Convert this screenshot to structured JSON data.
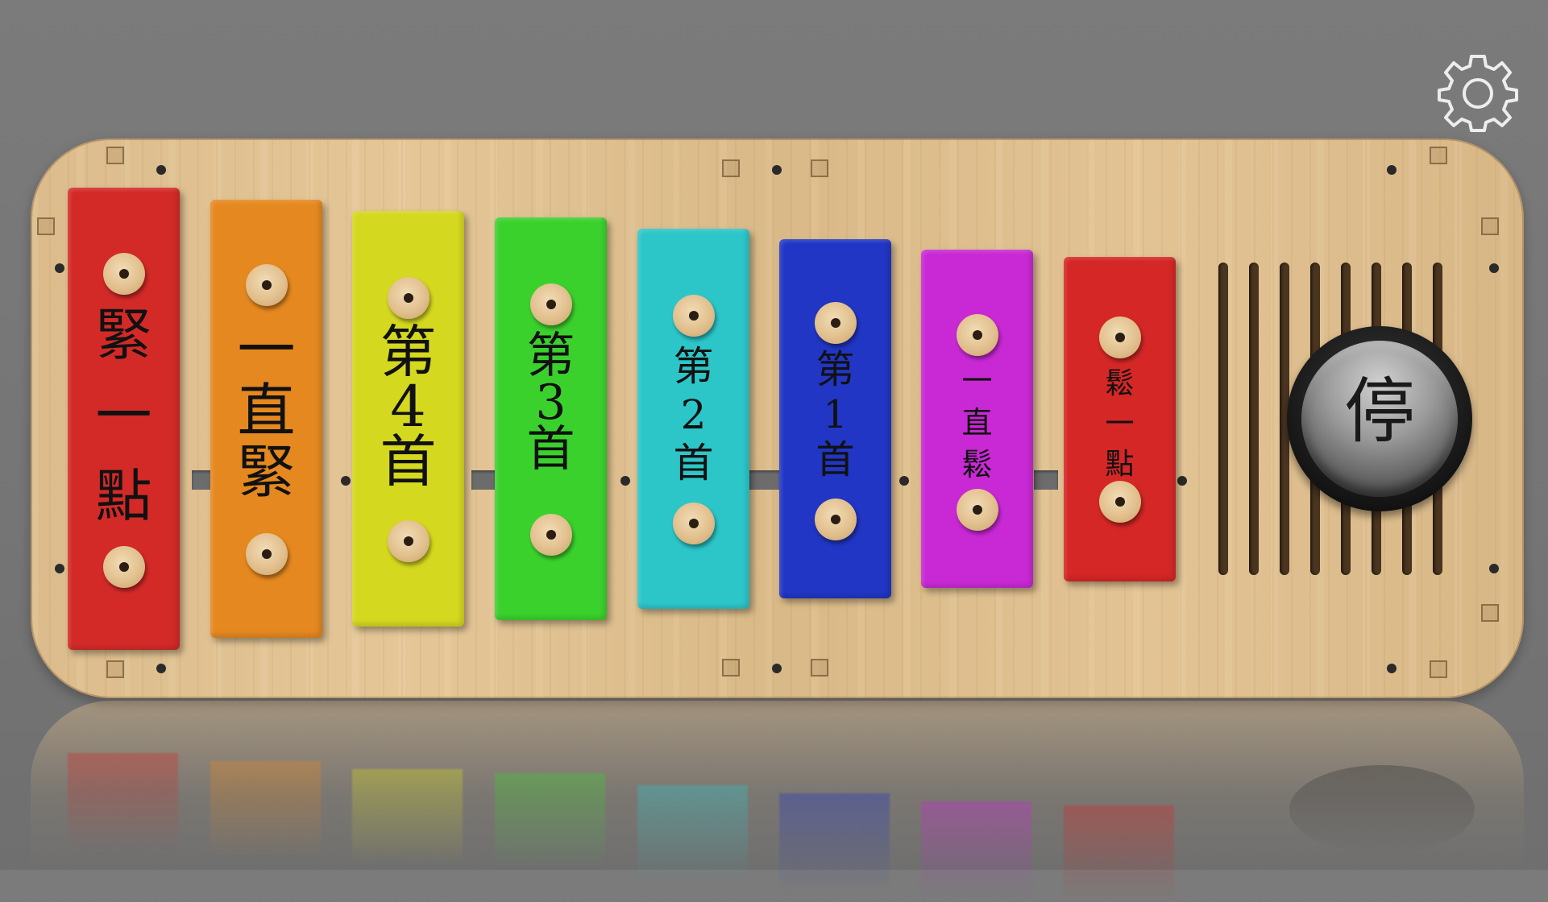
{
  "settings": {
    "icon": "gear-icon"
  },
  "bars": [
    {
      "id": "tighten-little",
      "chars": [
        "緊",
        "一",
        "點"
      ],
      "color": "#d32a28"
    },
    {
      "id": "keep-tightening",
      "chars": [
        "一",
        "直",
        "緊"
      ],
      "color": "#e5881f"
    },
    {
      "id": "song-4",
      "chars": [
        "第",
        "4",
        "首"
      ],
      "color": "#d4d81f"
    },
    {
      "id": "song-3",
      "chars": [
        "第",
        "3",
        "首"
      ],
      "color": "#3bd12d"
    },
    {
      "id": "song-2",
      "chars": [
        "第",
        "2",
        "首"
      ],
      "color": "#2cc6c9"
    },
    {
      "id": "song-1",
      "chars": [
        "第",
        "1",
        "首"
      ],
      "color": "#2136c4"
    },
    {
      "id": "keep-loosening",
      "chars": [
        "一",
        "直",
        "鬆"
      ],
      "color": "#c829d4"
    },
    {
      "id": "loosen-little",
      "chars": [
        "鬆",
        "一",
        "點"
      ],
      "color": "#d42726"
    }
  ],
  "stop_button": {
    "label": "停"
  }
}
